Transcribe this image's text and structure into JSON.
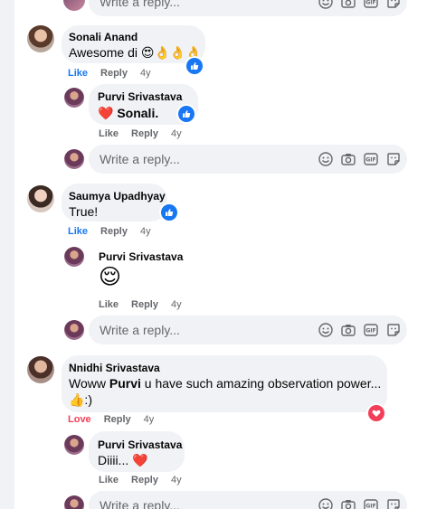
{
  "reply_placeholder": "Write a reply...",
  "colors": {
    "like_blue": "#1877f2",
    "love_red": "#f33e58",
    "muted": "#65676b",
    "bubble": "#f0f2f5"
  },
  "comments": [
    {
      "author": "Sonali Anand",
      "text": "Awesome di 😍👌👌👌",
      "actions": {
        "like": "Like",
        "reply": "Reply",
        "time": "4y"
      },
      "reaction_icon": "like-badge-icon",
      "replies": [
        {
          "author": "Purvi Srivastava",
          "heart": "❤️",
          "text": "Sonali.",
          "actions": {
            "like": "Like",
            "reply": "Reply",
            "time": "4y"
          },
          "reaction_icon": "like-badge-icon"
        }
      ]
    },
    {
      "author": "Saumya Upadhyay",
      "text": "True!",
      "actions": {
        "like": "Like",
        "reply": "Reply",
        "time": "4y"
      },
      "reaction_icon": "like-badge-icon",
      "replies": [
        {
          "author": "Purvi Srivastava",
          "emoji": "😌",
          "actions": {
            "like": "Like",
            "reply": "Reply",
            "time": "4y"
          }
        }
      ]
    },
    {
      "author": "Nnidhi Srivastava",
      "text_pre": "Woww ",
      "text_mention": "Purvi",
      "text_post": " u have such amazing observation power...",
      "text_line2": "👍:)",
      "actions": {
        "like": "Love",
        "reply": "Reply",
        "time": "4y"
      },
      "reaction_icon": "love-badge-icon",
      "replies": [
        {
          "author": "Purvi Srivastava",
          "text": "Diiii... ❤️",
          "actions": {
            "like": "Like",
            "reply": "Reply",
            "time": "4y"
          }
        }
      ]
    }
  ],
  "toolbar_icons": [
    "emoji-icon",
    "camera-icon",
    "gif-icon",
    "sticker-icon"
  ]
}
